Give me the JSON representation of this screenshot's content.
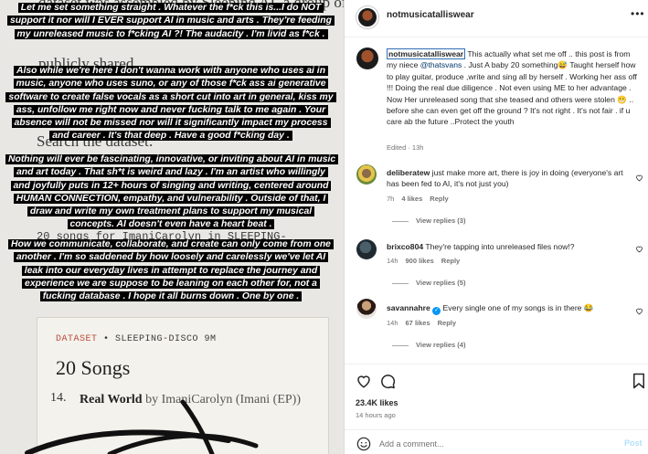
{
  "story": {
    "background_lines": [
      "dataset was assembled by Sleeping AI, a group of",
      "publicly shared",
      "Search the dataset:",
      "20 songs for ImaniCarolyn in SLEEPING-"
    ],
    "caption_blocks": [
      "Let me set something straight . Whatever the f*ck this is...I do NOT support it nor will I EVER support AI in music and arts . They're feeding my unreleased music to f*cking AI ?! The audacity . I'm livid as f*ck .",
      "Also while we're here I don't wanna work with anyone who uses ai in music, anyone who uses suno, or any of those f*ck ass ai generative software to create false vocals as a short cut into art in general, kiss my ass, unfollow me right now and never fucking talk to me again . Your absence will not be missed nor will it significantly impact my process and career . It's that deep . Have a good f*cking day .",
      "Nothing will ever be fascinating, innovative, or inviting about AI in music and art today . That sh*t is weird and lazy . I'm an artist who willingly and joyfully puts in 12+ hours of singing and writing, centered around HUMAN CONNECTION, empathy, and vulnerability . Outside of that, I draw and write my own treatment plans to support my musical concepts. AI doesn't even have a heart beat .",
      "How we communicate, collaborate, and create can only come from one another . I'm so saddened by how loosely and carelessly we've let AI leak into our everyday lives in attempt to replace the journey and experience we are suppose to be leaning on each other for, not a fucking database . I hope it all burns down . One by one ."
    ],
    "card": {
      "label_accent": "DATASET",
      "label_rest": " • SLEEPING-DISCO 9M",
      "title": "20 Songs",
      "item_number": "14.",
      "item_title": "Real World",
      "item_by": " by ImaniCarolyn (Imani (EP))",
      "item_next": "5.   Sl   Gi  l  by ImaniC"
    }
  },
  "header": {
    "username": "notmusicatalliswear",
    "more": "•••"
  },
  "caption": {
    "username": "notmusicatalliswear",
    "text_before_mention": " This actually what set me off .. this post is from my niece ",
    "mention": "@thatsvans",
    "text_after_mention": " . Just A baby 20 something😅 Taught herself how to play guitar, produce ,write and sing all by herself . Working her ass off !!! Doing the real due diligence . Not even using ME to her advantage . Now Her unreleased song that she teased and others were stolen 😬 .. before she can even get off the ground ? It's not right . It's not fair . if u care ab the future ..Protect the youth",
    "meta": "Edited · 13h"
  },
  "comments": [
    {
      "username": "deliberatew",
      "text": " just make more art, there is joy in doing (everyone's art has been fed to AI, it's not just you)",
      "age": "7h",
      "likes": "4 likes",
      "reply": "Reply",
      "view_replies": "View replies (3)"
    },
    {
      "username": "brixco804",
      "text": " They're tapping into unreleased files now!?",
      "age": "14h",
      "likes": "900 likes",
      "reply": "Reply",
      "view_replies": "View replies (5)"
    },
    {
      "username": "savannahre",
      "text": " Every single one of my songs is in there 😂",
      "age": "14h",
      "likes": "67 likes",
      "reply": "Reply",
      "view_replies": "View replies (4)"
    }
  ],
  "actions": {
    "likes": "23.4K likes",
    "time_ago": "14 hours ago"
  },
  "add_comment": {
    "placeholder": "Add a comment...",
    "post": "Post"
  },
  "colors": {
    "link": "#00376b",
    "post_disabled": "#b2dffc",
    "verified": "#0095f6",
    "dataset_label": "#b94b3b"
  }
}
